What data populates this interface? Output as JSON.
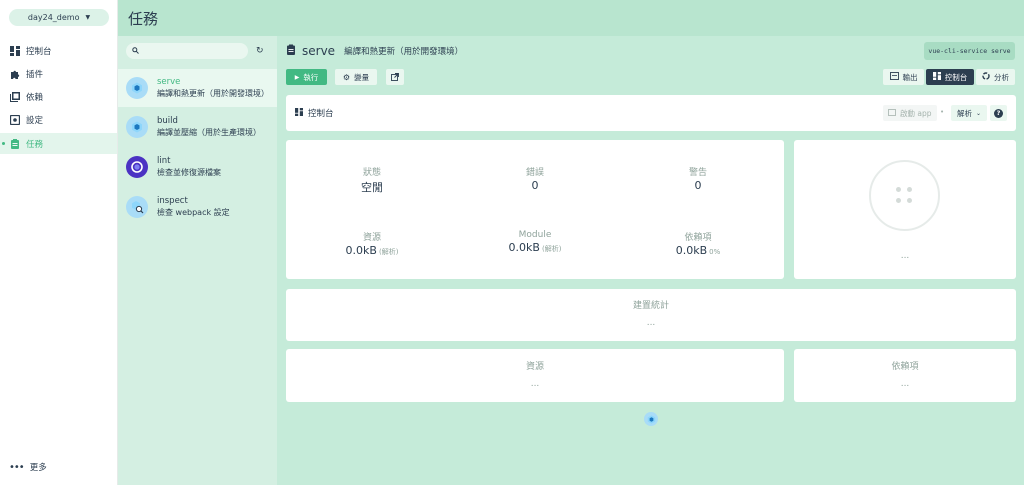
{
  "nav": {
    "project": "day24_demo",
    "items": [
      {
        "label": "控制台",
        "icon": "dashboard-icon"
      },
      {
        "label": "插件",
        "icon": "puzzle-icon"
      },
      {
        "label": "依賴",
        "icon": "library-icon"
      },
      {
        "label": "設定",
        "icon": "settings-icon"
      },
      {
        "label": "任務",
        "icon": "clipboard-icon",
        "active": true
      }
    ],
    "more_label": "更多"
  },
  "header": {
    "title": "任務"
  },
  "task_list": {
    "search_placeholder": "",
    "tasks": [
      {
        "name": "serve",
        "desc": "編譯和熱更新（用於開發環境）",
        "active": true
      },
      {
        "name": "build",
        "desc": "編譯並壓縮（用於生產環境）"
      },
      {
        "name": "lint",
        "desc": "檢查並修復源檔案"
      },
      {
        "name": "inspect",
        "desc": "檢查 webpack 設定"
      }
    ]
  },
  "task_detail": {
    "name": "serve",
    "description": "編譯和熱更新（用於開發環境）",
    "command": "vue-cli-service serve",
    "run_label": "執行",
    "variables_label": "變量",
    "output_label": "輸出",
    "dashboard_label": "控制台",
    "analyze_label": "分析"
  },
  "dashboard": {
    "title": "控制台",
    "open_app_label": "啟動 app",
    "parse_label": "解析",
    "stats": {
      "status_label": "狀態",
      "status_value": "空閒",
      "errors_label": "錯誤",
      "errors_value": "0",
      "warnings_label": "警告",
      "warnings_value": "0",
      "assets_label": "資源",
      "assets_value": "0.0kB",
      "assets_sub": "(解析)",
      "modules_label": "Module",
      "modules_value": "0.0kB",
      "modules_sub": "(解析)",
      "deps_label": "依賴項",
      "deps_value": "0.0kB",
      "deps_sub": "0%"
    },
    "progress_placeholder": "...",
    "speed_title": "建置統計",
    "speed_value": "...",
    "assets_title": "資源",
    "assets_value": "...",
    "deps_title": "依賴項",
    "deps_value": "..."
  },
  "colors": {
    "accent": "#42b983",
    "dark": "#2c3e50",
    "header_bg": "#b8e5cf",
    "main_bg": "#c5ebd9",
    "list_bg": "#d4efe2"
  }
}
